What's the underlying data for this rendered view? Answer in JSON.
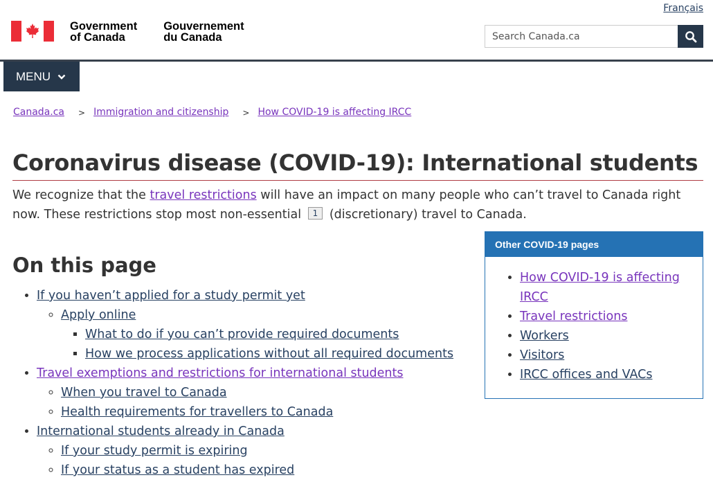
{
  "header": {
    "lang_link": "Français",
    "signature_en_line1": "Government",
    "signature_en_line2": "of Canada",
    "signature_fr_line1": "Gouvernement",
    "signature_fr_line2": "du Canada",
    "search_placeholder": "Search Canada.ca",
    "search_icon": "magnifier-icon",
    "menu_label": "MENU"
  },
  "breadcrumb": [
    "Canada.ca",
    "Immigration and citizenship",
    "How COVID-19 is affecting IRCC"
  ],
  "breadcrumb_separator": ">",
  "page_title": "Coronavirus disease (COVID-19): International students",
  "intro": {
    "part1": "We recognize that the ",
    "link": "travel restrictions",
    "part2": " will have an impact on many people who can’t travel to Canada right now. These restrictions stop most non-essential ",
    "footnote": "1",
    "part3": " (discretionary) travel to Canada."
  },
  "on_this_page": {
    "heading": "On this page",
    "items": [
      {
        "label": "If you haven’t applied for a study permit yet"
      },
      {
        "label": "Apply online"
      },
      {
        "label": "What to do if you can’t provide required documents"
      },
      {
        "label": "How we process applications without all required documents"
      },
      {
        "label": "Travel exemptions and restrictions for international students"
      },
      {
        "label": "When you travel to Canada"
      },
      {
        "label": "Health requirements for travellers to Canada"
      },
      {
        "label": "International students already in Canada"
      },
      {
        "label": "If your study permit is expiring"
      },
      {
        "label": "If your status as a student has expired"
      }
    ]
  },
  "side_panel": {
    "heading": "Other COVID-19 pages",
    "links": [
      "How COVID-19 is affecting IRCC",
      "Travel restrictions",
      "Workers",
      "Visitors",
      "IRCC offices and VACs"
    ]
  },
  "colors": {
    "header_dark": "#26374a",
    "link": "#284162",
    "visited_link": "#7834bc",
    "panel_blue": "#2572b4",
    "flag_red": "#eb2d37",
    "title_rule": "#af3c43"
  }
}
